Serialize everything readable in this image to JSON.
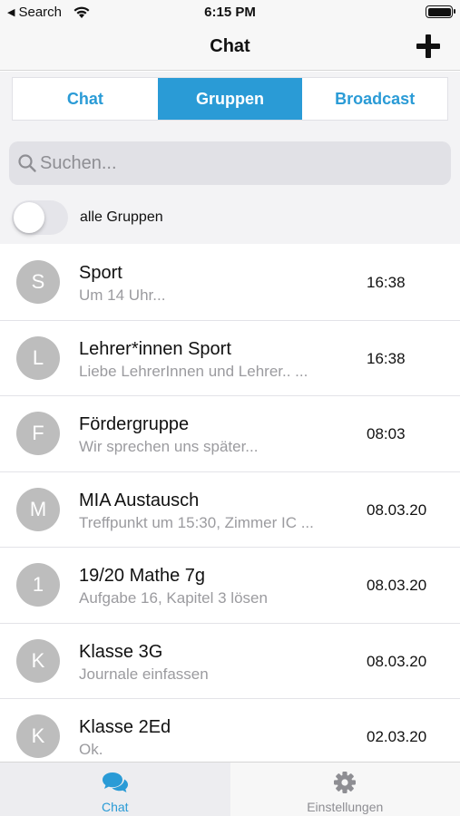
{
  "status_bar": {
    "back_label": "Search",
    "back_glyph": "◀",
    "time": "6:15 PM"
  },
  "nav": {
    "title": "Chat",
    "add_icon": "plus-icon"
  },
  "segments": [
    {
      "label": "Chat",
      "active": false
    },
    {
      "label": "Gruppen",
      "active": true
    },
    {
      "label": "Broadcast",
      "active": false
    }
  ],
  "search": {
    "placeholder": "Suchen...",
    "value": ""
  },
  "filter": {
    "label": "alle Gruppen",
    "on": false
  },
  "chats": [
    {
      "initial": "S",
      "title": "Sport",
      "preview": "Um 14 Uhr...",
      "time": "16:38"
    },
    {
      "initial": "L",
      "title": "Lehrer*innen Sport",
      "preview": "Liebe LehrerInnen und Lehrer.. ...",
      "time": "16:38"
    },
    {
      "initial": "F",
      "title": "Fördergruppe",
      "preview": "Wir sprechen uns später...",
      "time": "08:03"
    },
    {
      "initial": "M",
      "title": "MIA Austausch",
      "preview": "Treffpunkt um 15:30, Zimmer IC ...",
      "time": "08.03.20"
    },
    {
      "initial": "1",
      "title": "19/20 Mathe 7g",
      "preview": "Aufgabe 16, Kapitel 3 lösen",
      "time": "08.03.20"
    },
    {
      "initial": "K",
      "title": "Klasse 3G",
      "preview": "Journale einfassen",
      "time": "08.03.20"
    },
    {
      "initial": "K",
      "title": "Klasse 2Ed",
      "preview": "Ok.",
      "time": "02.03.20"
    }
  ],
  "tabs": [
    {
      "label": "Chat",
      "icon": "chat-bubbles-icon",
      "active": true
    },
    {
      "label": "Einstellungen",
      "icon": "gear-icon",
      "active": false
    }
  ],
  "colors": {
    "accent": "#2a9bd6",
    "avatar": "#bdbdbd",
    "muted_text": "#9b9b9f"
  }
}
